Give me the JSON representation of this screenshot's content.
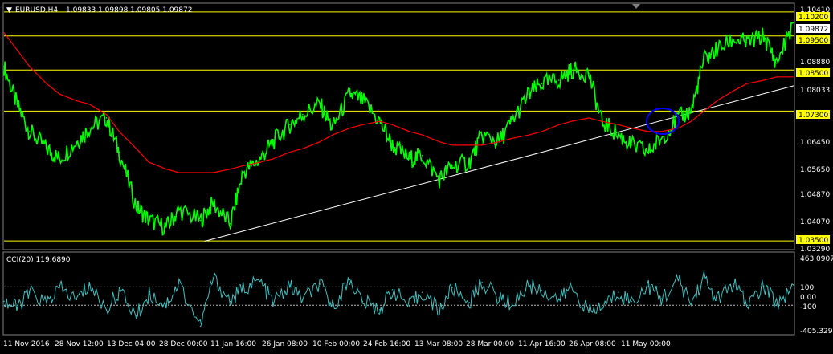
{
  "header": {
    "arrow": "▼",
    "symbol_tf": "EURUSD,H4",
    "ohlc": "1.09833 1.09898 1.09805 1.09872"
  },
  "indicator": {
    "label": "CCI(20) 119.6890",
    "axis_labels": [
      "463.0907",
      "100",
      "0.00",
      "-100",
      "-405.3295"
    ]
  },
  "price_axis": {
    "labels": [
      "1.10410",
      "1.09872",
      "1.08880",
      "1.08033",
      "1.06450",
      "1.05650",
      "1.04870",
      "1.04070",
      "1.03290"
    ],
    "level_tags": [
      "1.10200",
      "1.09500",
      "1.08500",
      "1.07300",
      "1.03500"
    ]
  },
  "time_axis": {
    "labels": [
      "11 Nov 2016",
      "28 Nov 12:00",
      "13 Dec 04:00",
      "28 Dec 00:00",
      "11 Jan 16:00",
      "26 Jan 08:00",
      "10 Feb 00:00",
      "24 Feb 16:00",
      "13 Mar 08:00",
      "28 Mar 00:00",
      "11 Apr 16:00",
      "26 Apr 08:00",
      "11 May 00:00"
    ]
  },
  "colors": {
    "background": "#000000",
    "price": "#00ff00",
    "ma": "#ff0000",
    "level_line": "#ffff00",
    "trendline": "#ffffff",
    "ellipse": "#0000ff",
    "cci": "#40c0c0",
    "axis_text": "#ffffff",
    "tag_bg": "#ffff00"
  },
  "chart_data": [
    {
      "type": "line",
      "price_range": [
        1.0329,
        1.1041
      ],
      "time_range": [
        "2016-11-11",
        "2017-05-15"
      ],
      "horizontal_levels": [
        1.102,
        1.095,
        1.085,
        1.073,
        1.035
      ],
      "trendline": {
        "from": [
          "2016-12-28",
          1.0349
        ],
        "to": [
          "2017-05-15",
          1.0804
        ]
      },
      "x": [
        "2016-11-11",
        "2016-11-14",
        "2016-11-17",
        "2016-11-21",
        "2016-11-24",
        "2016-11-28",
        "2016-12-01",
        "2016-12-05",
        "2016-12-08",
        "2016-12-12",
        "2016-12-15",
        "2016-12-19",
        "2016-12-22",
        "2016-12-27",
        "2016-12-30",
        "2017-01-03",
        "2017-01-06",
        "2017-01-10",
        "2017-01-13",
        "2017-01-17",
        "2017-01-20",
        "2017-01-24",
        "2017-01-27",
        "2017-01-31",
        "2017-02-03",
        "2017-02-07",
        "2017-02-10",
        "2017-02-14",
        "2017-02-17",
        "2017-02-21",
        "2017-02-24",
        "2017-02-28",
        "2017-03-03",
        "2017-03-07",
        "2017-03-10",
        "2017-03-14",
        "2017-03-17",
        "2017-03-21",
        "2017-03-24",
        "2017-03-28",
        "2017-03-31",
        "2017-04-04",
        "2017-04-07",
        "2017-04-11",
        "2017-04-14",
        "2017-04-18",
        "2017-04-21",
        "2017-04-24",
        "2017-04-27",
        "2017-05-01",
        "2017-05-04",
        "2017-05-08",
        "2017-05-11",
        "2017-05-15"
      ],
      "series": [
        {
          "name": "EURUSD",
          "values": [
            1.086,
            1.075,
            1.067,
            1.062,
            1.059,
            1.064,
            1.068,
            1.071,
            1.061,
            1.045,
            1.041,
            1.039,
            1.044,
            1.041,
            1.046,
            1.04,
            1.055,
            1.059,
            1.064,
            1.069,
            1.072,
            1.075,
            1.068,
            1.078,
            1.076,
            1.07,
            1.063,
            1.059,
            1.06,
            1.053,
            1.057,
            1.058,
            1.066,
            1.064,
            1.07,
            1.078,
            1.081,
            1.082,
            1.085,
            1.084,
            1.07,
            1.066,
            1.063,
            1.061,
            1.065,
            1.071,
            1.073,
            1.088,
            1.091,
            1.094,
            1.093,
            1.095,
            1.087,
            1.099
          ]
        },
        {
          "name": "MA",
          "values": [
            1.096,
            1.091,
            1.086,
            1.081,
            1.078,
            1.076,
            1.075,
            1.072,
            1.067,
            1.062,
            1.058,
            1.056,
            1.055,
            1.055,
            1.055,
            1.056,
            1.057,
            1.058,
            1.059,
            1.061,
            1.062,
            1.064,
            1.066,
            1.068,
            1.069,
            1.07,
            1.069,
            1.067,
            1.066,
            1.064,
            1.063,
            1.063,
            1.063,
            1.064,
            1.065,
            1.066,
            1.067,
            1.069,
            1.07,
            1.071,
            1.07,
            1.069,
            1.068,
            1.067,
            1.067,
            1.068,
            1.07,
            1.073,
            1.076,
            1.079,
            1.081,
            1.082,
            1.083,
            1.083
          ]
        }
      ]
    },
    {
      "type": "line",
      "name": "CCI(20)",
      "ylim": [
        -405.3295,
        463.0907
      ],
      "reference_lines": [
        100,
        -100
      ],
      "x": [
        "2016-11-11",
        "2016-11-14",
        "2016-11-17",
        "2016-11-21",
        "2016-11-24",
        "2016-11-28",
        "2016-12-01",
        "2016-12-05",
        "2016-12-08",
        "2016-12-12",
        "2016-12-15",
        "2016-12-19",
        "2016-12-22",
        "2016-12-27",
        "2016-12-30",
        "2017-01-03",
        "2017-01-06",
        "2017-01-10",
        "2017-01-13",
        "2017-01-17",
        "2017-01-20",
        "2017-01-24",
        "2017-01-27",
        "2017-01-31",
        "2017-02-03",
        "2017-02-07",
        "2017-02-10",
        "2017-02-14",
        "2017-02-17",
        "2017-02-21",
        "2017-02-24",
        "2017-02-28",
        "2017-03-03",
        "2017-03-07",
        "2017-03-10",
        "2017-03-14",
        "2017-03-17",
        "2017-03-21",
        "2017-03-24",
        "2017-03-28",
        "2017-03-31",
        "2017-04-04",
        "2017-04-07",
        "2017-04-11",
        "2017-04-14",
        "2017-04-18",
        "2017-04-21",
        "2017-04-24",
        "2017-04-27",
        "2017-05-01",
        "2017-05-04",
        "2017-05-08",
        "2017-05-11",
        "2017-05-15"
      ],
      "series": [
        {
          "name": "CCI",
          "values": [
            -60,
            -130,
            40,
            -80,
            90,
            -40,
            120,
            -150,
            60,
            -220,
            20,
            -90,
            140,
            -330,
            200,
            -60,
            90,
            160,
            -70,
            110,
            -40,
            130,
            -120,
            180,
            -60,
            -150,
            70,
            -110,
            40,
            -160,
            90,
            -70,
            150,
            -20,
            -90,
            120,
            60,
            -40,
            100,
            -180,
            -120,
            40,
            -60,
            110,
            -30,
            170,
            -80,
            200,
            -50,
            140,
            -100,
            110,
            -90,
            120
          ]
        }
      ]
    }
  ]
}
